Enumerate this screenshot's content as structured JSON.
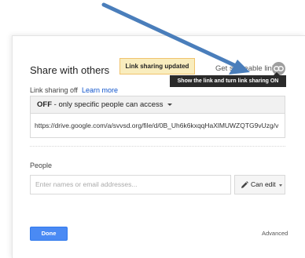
{
  "dialog": {
    "title": "Share with others",
    "notice": "Link sharing updated",
    "get_link_label": "Get shareable link",
    "link_icon": "link-icon",
    "tooltip": "Show the link and turn link sharing ON"
  },
  "link_sharing": {
    "status": "Link sharing off",
    "learn_more": "Learn more",
    "access_option_bold": "OFF",
    "access_option_rest": " - only specific people can access",
    "url": "https://drive.google.com/a/svvsd.org/file/d/0B_Uh6k6kxqqHaXlMUWZQTG9vUzg/v"
  },
  "people": {
    "label": "People",
    "input_placeholder": "Enter names or email addresses...",
    "permission_label": "Can edit",
    "permission_icon": "pencil-icon"
  },
  "footer": {
    "done_label": "Done",
    "advanced_label": "Advanced"
  },
  "colors": {
    "arrow": "#4a7ebb",
    "notice_bg": "#f9edbe",
    "done_bg": "#4a8af4",
    "link_blue": "#1155cc",
    "tooltip_bg": "#2a2a2a"
  }
}
